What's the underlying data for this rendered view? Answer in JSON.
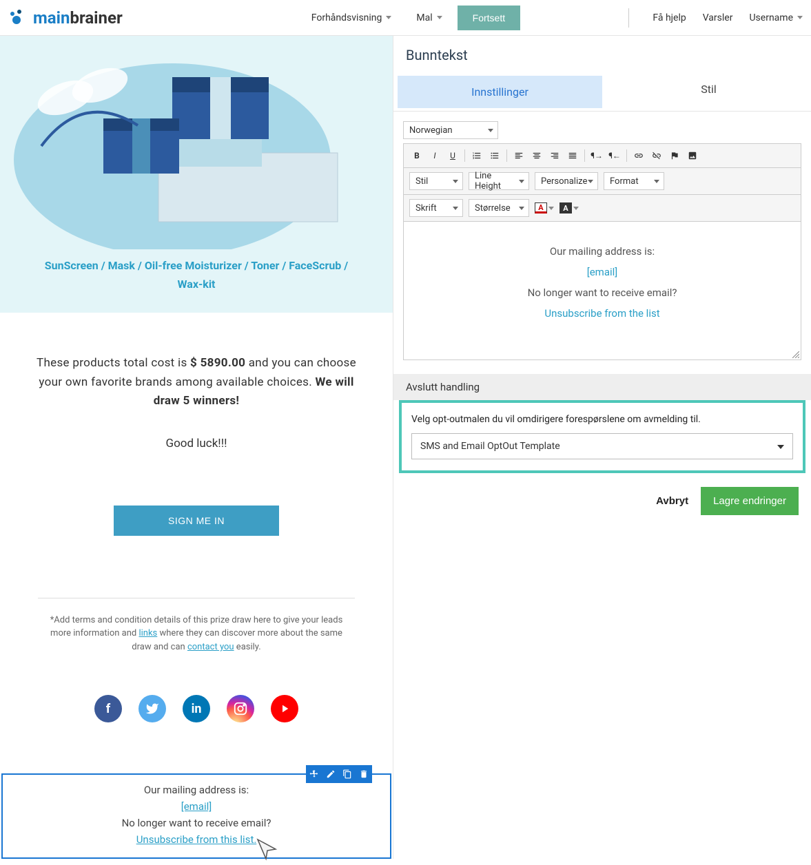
{
  "topbar": {
    "logo_main": "main",
    "logo_brain": "brainer",
    "preview": "Forhåndsvisning",
    "template": "Mal",
    "continue": "Fortsett",
    "help": "Få hjelp",
    "alerts": "Varsler",
    "username": "Username"
  },
  "preview": {
    "hero_products": "SunScreen / Mask / Oil-free Moisturizer / Toner / FaceScrub / Wax-kit",
    "body_pre": "These products total cost is ",
    "body_price": "$ 5890.00",
    "body_mid": " and you can choose your own favorite brands among available choices. ",
    "body_bold": "We will draw 5 winners!",
    "goodluck": "Good luck!!!",
    "sign_btn": "SIGN ME IN",
    "terms_pre": "*Add terms and condition details of this prize draw here to give your leads more information and ",
    "terms_link1": "links",
    "terms_mid": " where they can discover more about the same draw and can ",
    "terms_link2": "contact you",
    "terms_post": " easily.",
    "footer_line1": "Our mailing address is:",
    "footer_email": "[email]",
    "footer_line2": "No longer want to receive email?",
    "footer_unsub": "Unsubscribe from this list."
  },
  "sidebar": {
    "title": "Bunntekst",
    "tab_settings": "Innstillinger",
    "tab_style": "Stil",
    "language": "Norwegian",
    "toolbar": {
      "style": "Stil",
      "lineheight": "Line Height",
      "personalize": "Personalize",
      "format": "Format",
      "font": "Skrift",
      "size": "Størrelse"
    },
    "editor": {
      "line1": "Our mailing address is:",
      "email": "[email]",
      "line2": "No longer want to receive email?",
      "unsub": "Unsubscribe from the list"
    },
    "section_end": "Avslutt handling",
    "optout_label": "Velg opt-outmalen du vil omdirigere forespørslene om avmelding til.",
    "optout_value": "SMS and Email OptOut Template",
    "cancel": "Avbryt",
    "save": "Lagre endringer"
  }
}
